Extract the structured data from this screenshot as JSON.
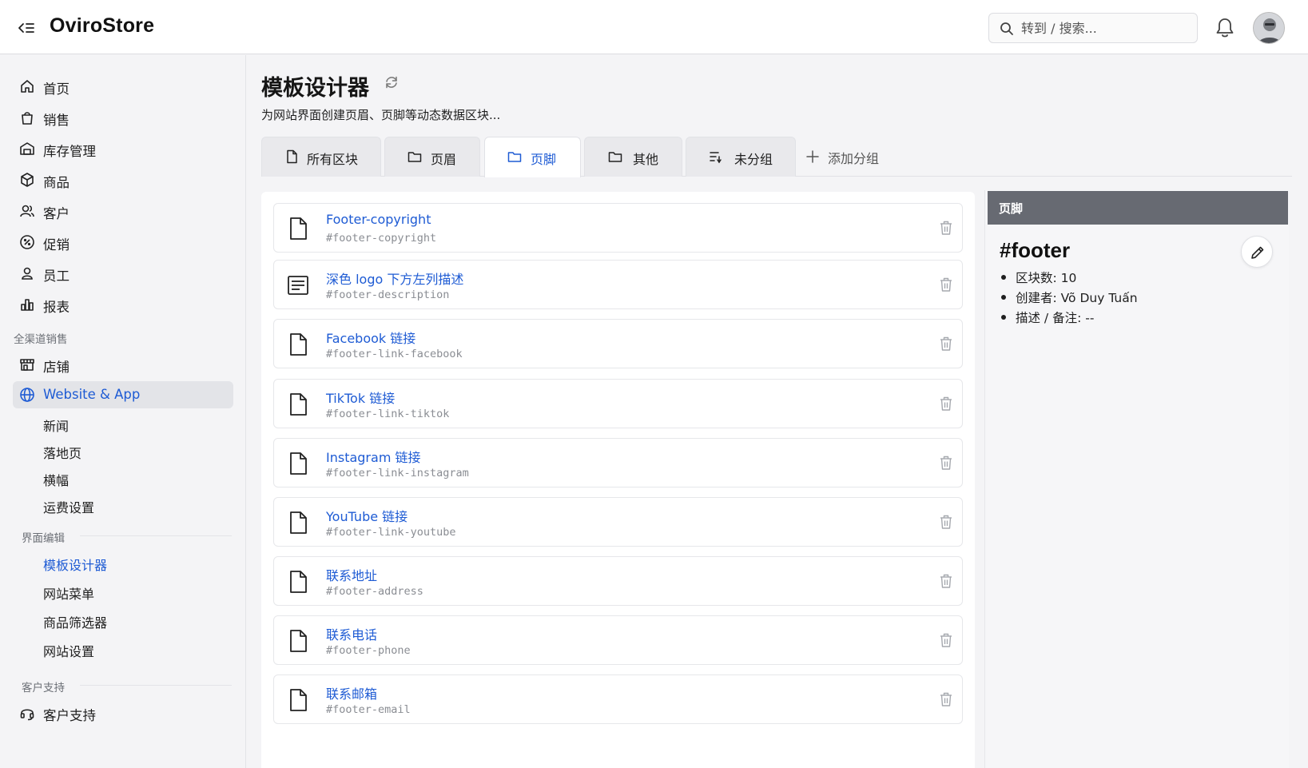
{
  "header": {
    "brand": "OviroStore",
    "search_placeholder": "转到 / 搜索..."
  },
  "sidebar": {
    "items": [
      {
        "label": "首页",
        "icon": "home-icon"
      },
      {
        "label": "销售",
        "icon": "shopping-bag-icon"
      },
      {
        "label": "库存管理",
        "icon": "warehouse-icon"
      },
      {
        "label": "商品",
        "icon": "package-icon"
      },
      {
        "label": "客户",
        "icon": "users-icon"
      },
      {
        "label": "促销",
        "icon": "discount-icon"
      },
      {
        "label": "员工",
        "icon": "user-icon"
      },
      {
        "label": "报表",
        "icon": "bar-chart-icon"
      }
    ],
    "omni_section": "全渠道销售",
    "store_label": "店铺",
    "website_label": "Website & App",
    "website_subitems": [
      "新闻",
      "落地页",
      "横幅",
      "运费设置"
    ],
    "ui_section": "界面编辑",
    "ui_subitems": [
      "模板设计器",
      "网站菜单",
      "商品筛选器",
      "网站设置"
    ],
    "support_section": "客户支持",
    "support_label": "客户支持"
  },
  "main": {
    "title": "模板设计器",
    "subtitle": "为网站界面创建页眉、页脚等动态数据区块...",
    "tabs": [
      {
        "label": "所有区块",
        "icon": "file-icon"
      },
      {
        "label": "页眉",
        "icon": "folder-icon"
      },
      {
        "label": "页脚",
        "icon": "folder-icon",
        "active": true
      },
      {
        "label": "其他",
        "icon": "folder-icon"
      },
      {
        "label": "未分组",
        "icon": "list-filter-icon"
      }
    ],
    "add_group_label": "添加分组",
    "items": [
      {
        "title": "Footer-copyright",
        "id": "#footer-copyright",
        "icon": "file-icon"
      },
      {
        "title": "深色 logo 下方左列描述",
        "id": "#footer-description",
        "icon": "text-block-icon"
      },
      {
        "title": "Facebook 链接",
        "id": "#footer-link-facebook",
        "icon": "file-icon"
      },
      {
        "title": "TikTok 链接",
        "id": "#footer-link-tiktok",
        "icon": "file-icon"
      },
      {
        "title": "Instagram 链接",
        "id": "#footer-link-instagram",
        "icon": "file-icon"
      },
      {
        "title": "YouTube 链接",
        "id": "#footer-link-youtube",
        "icon": "file-icon"
      },
      {
        "title": "联系地址",
        "id": "#footer-address",
        "icon": "file-icon"
      },
      {
        "title": "联系电话",
        "id": "#footer-phone",
        "icon": "file-icon"
      },
      {
        "title": "联系邮箱",
        "id": "#footer-email",
        "icon": "file-icon"
      }
    ]
  },
  "detail": {
    "header": "页脚",
    "name": "#footer",
    "block_count": "区块数: 10",
    "creator": "创建者: Võ Duy Tuấn",
    "note": "描述 / 备注: --"
  },
  "colors": {
    "accent": "#1e5bd4",
    "detail_header": "#676a72",
    "sidebar_bg": "#f4f4f6"
  }
}
